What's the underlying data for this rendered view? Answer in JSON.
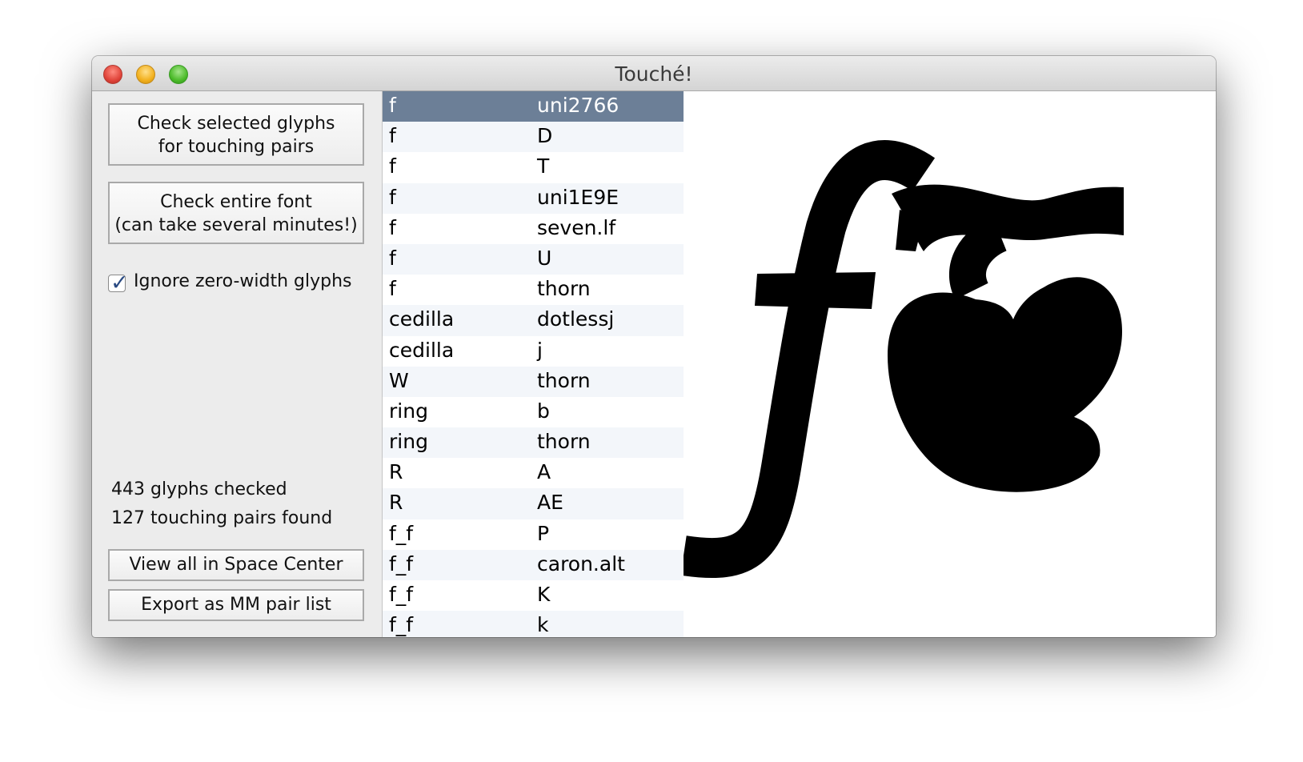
{
  "window": {
    "title": "Touché!"
  },
  "left_panel": {
    "check_selected_button": {
      "line1": "Check selected glyphs",
      "line2": "for touching pairs"
    },
    "check_entire_button": {
      "line1": "Check entire font",
      "line2": "(can take several minutes!)"
    },
    "ignore_zero_width": {
      "label": "Ignore zero-width glyphs",
      "checked": true
    },
    "glyphs_checked": "443 glyphs checked",
    "pairs_found": "127 touching pairs found",
    "view_all_button": "View all in Space Center",
    "export_button": "Export as MM pair list"
  },
  "pair_list": {
    "selected_index": 0,
    "rows": [
      [
        "f",
        "uni2766"
      ],
      [
        "f",
        "D"
      ],
      [
        "f",
        "T"
      ],
      [
        "f",
        "uni1E9E"
      ],
      [
        "f",
        "seven.lf"
      ],
      [
        "f",
        "U"
      ],
      [
        "f",
        "thorn"
      ],
      [
        "cedilla",
        "dotlessj"
      ],
      [
        "cedilla",
        "j"
      ],
      [
        "W",
        "thorn"
      ],
      [
        "ring",
        "b"
      ],
      [
        "ring",
        "thorn"
      ],
      [
        "R",
        "A"
      ],
      [
        "R",
        "AE"
      ],
      [
        "f_f",
        "P"
      ],
      [
        "f_f",
        "caron.alt"
      ],
      [
        "f_f",
        "K"
      ],
      [
        "f_f",
        "k"
      ]
    ]
  },
  "preview": {
    "left_glyph": "f",
    "right_glyph": "uni2766"
  }
}
